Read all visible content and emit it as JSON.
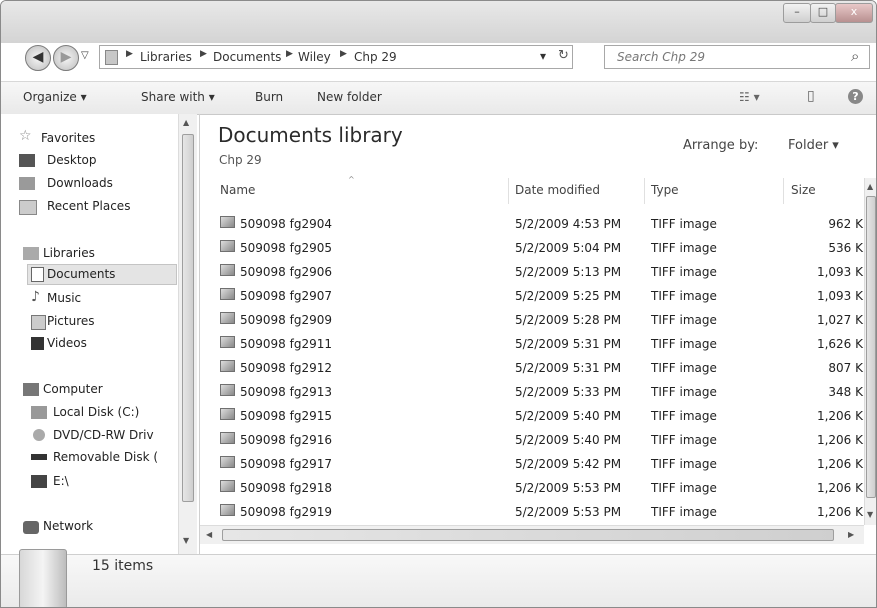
{
  "window_controls": {
    "minimize": "–",
    "maximize": "□",
    "close": "x"
  },
  "address": {
    "crumbs": [
      "Libraries",
      "Documents",
      "Wiley",
      "Chp 29"
    ],
    "separator": "▶",
    "dropdown": "▾",
    "refresh": "↻"
  },
  "search": {
    "placeholder": "Search Chp 29",
    "icon": "⌕"
  },
  "toolbar": {
    "organize": "Organize ▾",
    "share_with": "Share with ▾",
    "burn": "Burn",
    "new_folder": "New folder",
    "view_icon": "☷ ▾",
    "preview_icon": "▯",
    "help_icon": "?"
  },
  "nav": {
    "favorites": "Favorites",
    "desktop": "Desktop",
    "downloads": "Downloads",
    "recent_places": "Recent Places",
    "libraries": "Libraries",
    "documents": "Documents",
    "music": "Music",
    "pictures": "Pictures",
    "videos": "Videos",
    "computer": "Computer",
    "local_disk": "Local Disk (C:)",
    "dvd": "DVD/CD-RW Driv",
    "removable": "Removable Disk (",
    "e_drive": "E:\\",
    "network": "Network"
  },
  "library": {
    "title": "Documents library",
    "subtitle": "Chp 29",
    "arrange_label": "Arrange by:",
    "arrange_value": "Folder ▾"
  },
  "columns": {
    "name": "Name",
    "date": "Date modified",
    "type": "Type",
    "size": "Size"
  },
  "files": [
    {
      "name": "509098 fg2904",
      "date": "5/2/2009 4:53 PM",
      "type": "TIFF image",
      "size": "962 K"
    },
    {
      "name": "509098 fg2905",
      "date": "5/2/2009 5:04 PM",
      "type": "TIFF image",
      "size": "536 K"
    },
    {
      "name": "509098 fg2906",
      "date": "5/2/2009 5:13 PM",
      "type": "TIFF image",
      "size": "1,093 K"
    },
    {
      "name": "509098 fg2907",
      "date": "5/2/2009 5:25 PM",
      "type": "TIFF image",
      "size": "1,093 K"
    },
    {
      "name": "509098 fg2909",
      "date": "5/2/2009 5:28 PM",
      "type": "TIFF image",
      "size": "1,027 K"
    },
    {
      "name": "509098 fg2911",
      "date": "5/2/2009 5:31 PM",
      "type": "TIFF image",
      "size": "1,626 K"
    },
    {
      "name": "509098 fg2912",
      "date": "5/2/2009 5:31 PM",
      "type": "TIFF image",
      "size": "807 K"
    },
    {
      "name": "509098 fg2913",
      "date": "5/2/2009 5:33 PM",
      "type": "TIFF image",
      "size": "348 K"
    },
    {
      "name": "509098 fg2915",
      "date": "5/2/2009 5:40 PM",
      "type": "TIFF image",
      "size": "1,206 K"
    },
    {
      "name": "509098 fg2916",
      "date": "5/2/2009 5:40 PM",
      "type": "TIFF image",
      "size": "1,206 K"
    },
    {
      "name": "509098 fg2917",
      "date": "5/2/2009 5:42 PM",
      "type": "TIFF image",
      "size": "1,206 K"
    },
    {
      "name": "509098 fg2918",
      "date": "5/2/2009 5:53 PM",
      "type": "TIFF image",
      "size": "1,206 K"
    },
    {
      "name": "509098 fg2919",
      "date": "5/2/2009 5:53 PM",
      "type": "TIFF image",
      "size": "1,206 K"
    }
  ],
  "status": {
    "count": "15 items"
  }
}
